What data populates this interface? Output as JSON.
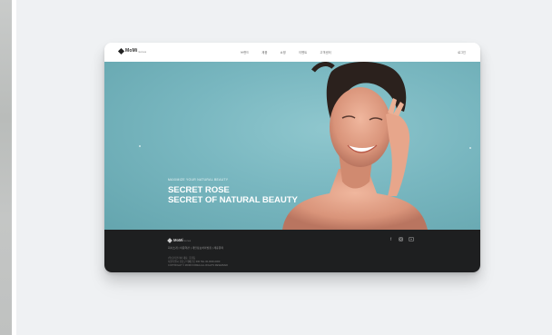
{
  "header": {
    "logo_text": "MoMi",
    "logo_sub": "korea",
    "nav": [
      "브랜드",
      "제품",
      "쇼핑",
      "이벤트",
      "고객센터"
    ],
    "login_label": "로그인"
  },
  "hero": {
    "eyebrow": "MAXIMIZE YOUR NATURAL BEAUTY",
    "headline_line1": "SECRET ROSE",
    "headline_line2": "SECRET OF NATURAL BEAUTY"
  },
  "footer": {
    "logo_text": "MoMi",
    "logo_sub": "korea",
    "links": "회사소개  |  이용약관  |  개인정보처리방침  |  제휴문의",
    "info_line1": "(주)모미코리아  대표: 홍길동",
    "info_line2": "서울특별시 강남구 테헤란로 000  TEL 00-0000-0000",
    "info_line3": "COPYRIGHT © MOMI KOREA ALL RIGHTS RESERVED",
    "social_icons": [
      "facebook-icon",
      "instagram-icon",
      "youtube-icon"
    ]
  },
  "colors": {
    "hero_bg": "#79b7c0",
    "footer_bg": "#1e1f20",
    "panel_bg": "#eff1f3"
  }
}
